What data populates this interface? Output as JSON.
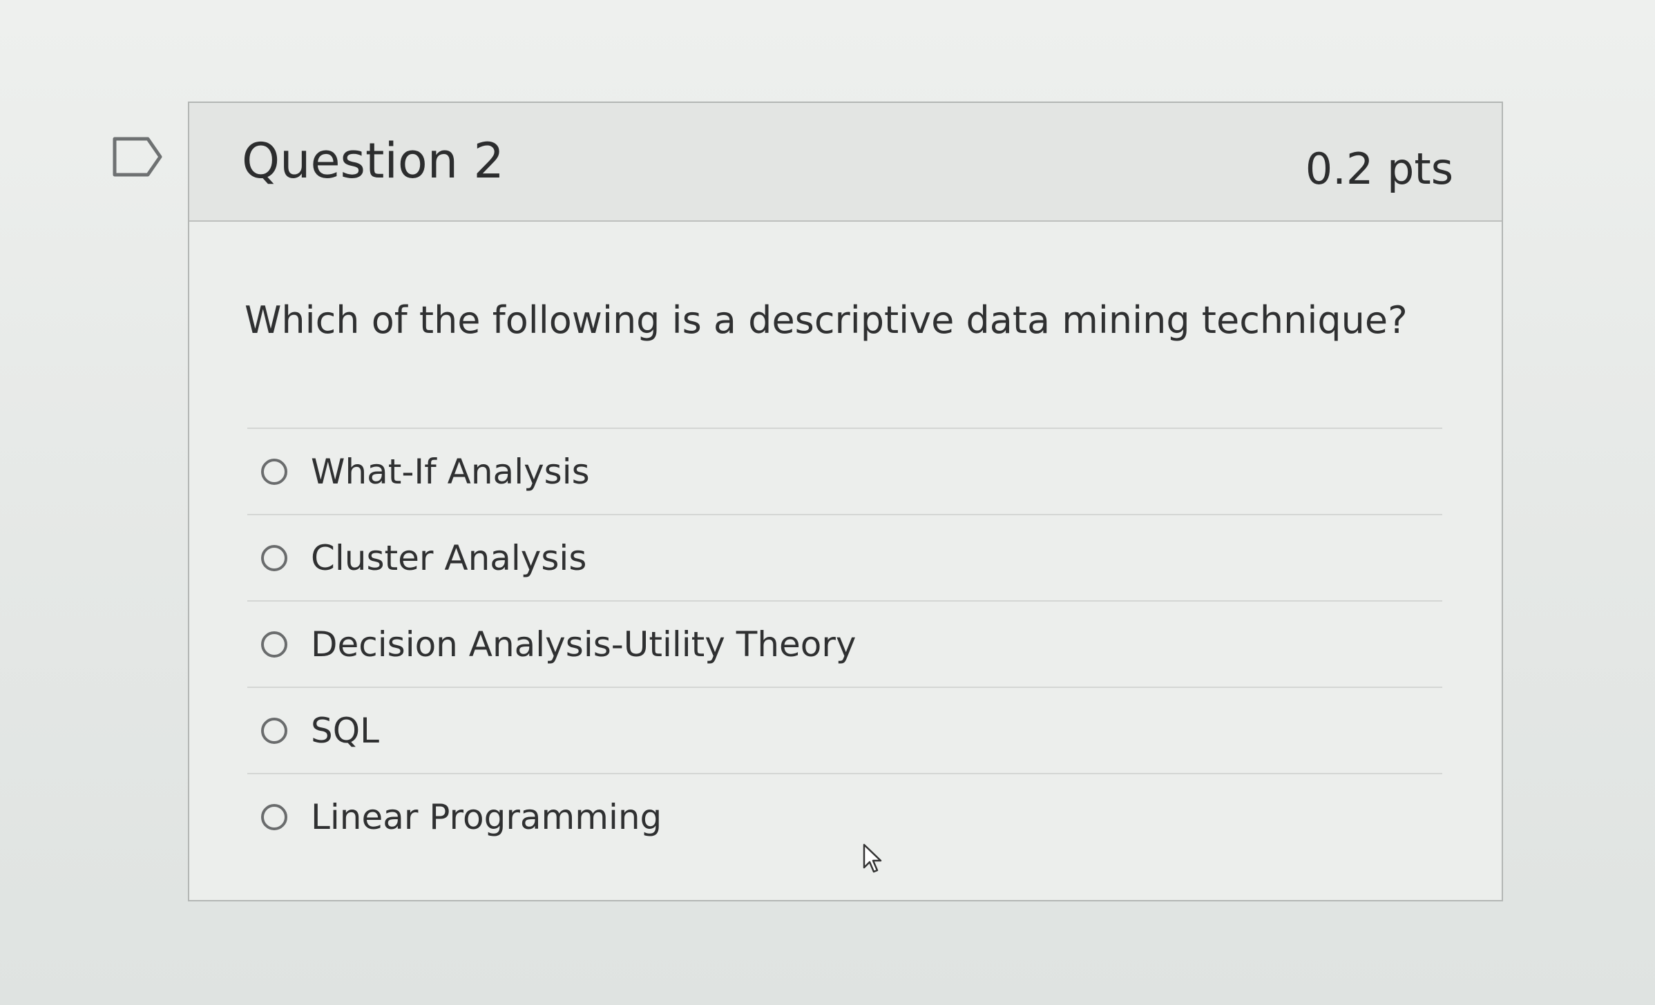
{
  "question": {
    "title": "Question 2",
    "points": "0.2 pts",
    "text": "Which of the following is a descriptive data mining technique?"
  },
  "answers": [
    {
      "label": "What-If Analysis",
      "selected": false
    },
    {
      "label": "Cluster Analysis",
      "selected": false
    },
    {
      "label": "Decision Analysis-Utility Theory",
      "selected": false
    },
    {
      "label": "SQL",
      "selected": false
    },
    {
      "label": "Linear Programming",
      "selected": false
    }
  ],
  "icons": {
    "flag": "flag-question-icon",
    "radio": "radio-unselected-icon",
    "cursor": "mouse-pointer-icon"
  },
  "colors": {
    "text": "#2f3031",
    "border": "#b3b6b4",
    "header_bg": "#e3e5e3",
    "radio": "#6a6c6d"
  }
}
